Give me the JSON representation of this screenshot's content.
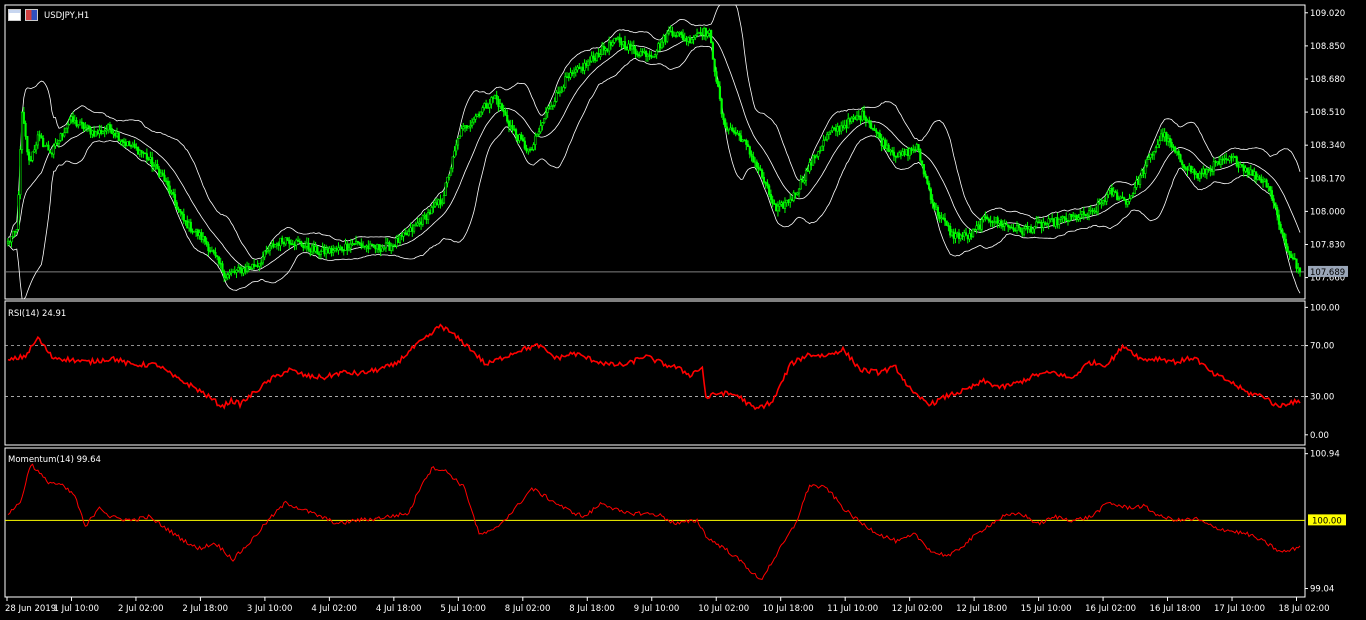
{
  "colors": {
    "background": "#000000",
    "frame": "#ffffff",
    "candle_up": "#00ff00",
    "candle_body_up": "#000000",
    "candle_down": "#00ff00",
    "bands": "#ffffff",
    "rsi": "#ff0000",
    "momentum": "#ff0000",
    "momentum_ref": "#ffff00",
    "price_line": "#808080",
    "price_tag": "#9aa6b8"
  },
  "header": {
    "symbol": "USDJPY,H1",
    "icons": [
      "chart-window-icon",
      "symbol-icon"
    ]
  },
  "chart_data": [
    {
      "type": "candlestick",
      "title": "USDJPY,H1",
      "ylim": [
        107.55,
        109.06
      ],
      "yticks": [
        "109.020",
        "108.850",
        "108.680",
        "108.510",
        "108.340",
        "108.170",
        "108.000",
        "107.830",
        "107.660"
      ],
      "ytick_values": [
        109.02,
        108.85,
        108.68,
        108.51,
        108.34,
        108.17,
        108.0,
        107.83,
        107.66
      ],
      "current_price": "107.689",
      "current_value": 107.689,
      "anchors": [
        [
          0,
          107.84
        ],
        [
          5,
          107.9
        ],
        [
          8,
          108.5
        ],
        [
          12,
          108.25
        ],
        [
          17,
          108.38
        ],
        [
          25,
          108.3
        ],
        [
          35,
          108.47
        ],
        [
          50,
          108.4
        ],
        [
          58,
          108.43
        ],
        [
          67,
          108.35
        ],
        [
          77,
          108.3
        ],
        [
          88,
          108.18
        ],
        [
          100,
          107.95
        ],
        [
          112,
          107.85
        ],
        [
          124,
          107.67
        ],
        [
          133,
          107.7
        ],
        [
          142,
          107.73
        ],
        [
          150,
          107.82
        ],
        [
          158,
          107.86
        ],
        [
          167,
          107.83
        ],
        [
          177,
          107.79
        ],
        [
          187,
          107.8
        ],
        [
          197,
          107.84
        ],
        [
          207,
          107.81
        ],
        [
          217,
          107.82
        ],
        [
          227,
          107.88
        ],
        [
          237,
          107.97
        ],
        [
          247,
          108.06
        ],
        [
          257,
          108.4
        ],
        [
          267,
          108.5
        ],
        [
          277,
          108.59
        ],
        [
          287,
          108.42
        ],
        [
          297,
          108.3
        ],
        [
          307,
          108.52
        ],
        [
          317,
          108.67
        ],
        [
          327,
          108.74
        ],
        [
          337,
          108.82
        ],
        [
          347,
          108.88
        ],
        [
          357,
          108.82
        ],
        [
          367,
          108.81
        ],
        [
          377,
          108.93
        ],
        [
          387,
          108.88
        ],
        [
          394,
          108.93
        ],
        [
          399,
          108.91
        ],
        [
          407,
          108.45
        ],
        [
          417,
          108.38
        ],
        [
          427,
          108.22
        ],
        [
          437,
          108.0
        ],
        [
          447,
          108.08
        ],
        [
          457,
          108.25
        ],
        [
          467,
          108.4
        ],
        [
          477,
          108.45
        ],
        [
          487,
          108.5
        ],
        [
          497,
          108.36
        ],
        [
          507,
          108.28
        ],
        [
          517,
          108.33
        ],
        [
          527,
          108.02
        ],
        [
          537,
          107.88
        ],
        [
          547,
          107.87
        ],
        [
          557,
          107.97
        ],
        [
          567,
          107.93
        ],
        [
          577,
          107.9
        ],
        [
          587,
          107.93
        ],
        [
          597,
          107.95
        ],
        [
          607,
          107.97
        ],
        [
          617,
          107.99
        ],
        [
          627,
          108.1
        ],
        [
          637,
          108.05
        ],
        [
          647,
          108.23
        ],
        [
          657,
          108.4
        ],
        [
          667,
          108.26
        ],
        [
          677,
          108.18
        ],
        [
          687,
          108.24
        ],
        [
          697,
          108.27
        ],
        [
          707,
          108.2
        ],
        [
          717,
          108.14
        ],
        [
          727,
          107.82
        ],
        [
          735,
          107.69
        ]
      ],
      "series": [
        {
          "name": "upper-band"
        },
        {
          "name": "middle-band"
        },
        {
          "name": "lower-band"
        }
      ]
    },
    {
      "type": "line",
      "label": "RSI(14) 24.91",
      "ylim": [
        0,
        100
      ],
      "yticks": [
        "100.00",
        "70.00",
        "30.00",
        "0.00"
      ],
      "ytick_values": [
        100,
        70,
        30,
        0
      ],
      "levels": [
        70,
        30
      ],
      "anchors": [
        [
          0,
          58
        ],
        [
          10,
          62
        ],
        [
          17,
          76
        ],
        [
          25,
          61
        ],
        [
          45,
          57
        ],
        [
          60,
          60
        ],
        [
          70,
          55
        ],
        [
          85,
          55
        ],
        [
          95,
          45
        ],
        [
          105,
          38
        ],
        [
          112,
          32
        ],
        [
          122,
          22
        ],
        [
          127,
          27
        ],
        [
          132,
          24
        ],
        [
          140,
          33
        ],
        [
          150,
          44
        ],
        [
          160,
          51
        ],
        [
          170,
          46
        ],
        [
          180,
          45
        ],
        [
          190,
          49
        ],
        [
          200,
          48
        ],
        [
          210,
          51
        ],
        [
          220,
          55
        ],
        [
          232,
          70
        ],
        [
          240,
          78
        ],
        [
          246,
          86
        ],
        [
          252,
          80
        ],
        [
          262,
          69
        ],
        [
          272,
          55
        ],
        [
          282,
          61
        ],
        [
          292,
          67
        ],
        [
          302,
          70
        ],
        [
          312,
          60
        ],
        [
          322,
          64
        ],
        [
          332,
          59
        ],
        [
          342,
          55
        ],
        [
          352,
          55
        ],
        [
          362,
          62
        ],
        [
          374,
          55
        ],
        [
          380,
          53
        ],
        [
          388,
          47
        ],
        [
          395,
          53
        ],
        [
          397,
          29
        ],
        [
          405,
          33
        ],
        [
          415,
          31
        ],
        [
          425,
          20
        ],
        [
          435,
          26
        ],
        [
          445,
          55
        ],
        [
          455,
          63
        ],
        [
          465,
          62
        ],
        [
          475,
          67
        ],
        [
          485,
          51
        ],
        [
          495,
          49
        ],
        [
          505,
          53
        ],
        [
          515,
          32
        ],
        [
          525,
          24
        ],
        [
          535,
          31
        ],
        [
          545,
          35
        ],
        [
          555,
          42
        ],
        [
          565,
          37
        ],
        [
          575,
          41
        ],
        [
          585,
          47
        ],
        [
          595,
          49
        ],
        [
          605,
          44
        ],
        [
          615,
          57
        ],
        [
          625,
          55
        ],
        [
          635,
          70
        ],
        [
          645,
          59
        ],
        [
          655,
          60
        ],
        [
          665,
          57
        ],
        [
          675,
          61
        ],
        [
          685,
          48
        ],
        [
          695,
          42
        ],
        [
          705,
          33
        ],
        [
          715,
          30
        ],
        [
          722,
          22
        ],
        [
          730,
          26
        ],
        [
          735,
          25
        ]
      ]
    },
    {
      "type": "line",
      "label": "Momentum(14) 99.64",
      "ylim": [
        99.04,
        100.94
      ],
      "yticks": [
        "100.94",
        "100.00",
        "99.04"
      ],
      "ytick_values": [
        100.94,
        100.0,
        99.04
      ],
      "levels": [
        100.0
      ],
      "highlighted_tick": "100.00",
      "anchors": [
        [
          0,
          100.1
        ],
        [
          7,
          100.25
        ],
        [
          13,
          100.8
        ],
        [
          22,
          100.55
        ],
        [
          30,
          100.5
        ],
        [
          38,
          100.35
        ],
        [
          44,
          99.9
        ],
        [
          52,
          100.2
        ],
        [
          58,
          100.05
        ],
        [
          70,
          100.0
        ],
        [
          80,
          100.05
        ],
        [
          88,
          99.92
        ],
        [
          98,
          99.75
        ],
        [
          108,
          99.6
        ],
        [
          118,
          99.68
        ],
        [
          128,
          99.45
        ],
        [
          138,
          99.7
        ],
        [
          148,
          100.0
        ],
        [
          158,
          100.25
        ],
        [
          168,
          100.15
        ],
        [
          178,
          100.05
        ],
        [
          188,
          99.95
        ],
        [
          198,
          100.0
        ],
        [
          208,
          100.02
        ],
        [
          218,
          100.06
        ],
        [
          228,
          100.1
        ],
        [
          236,
          100.55
        ],
        [
          242,
          100.75
        ],
        [
          250,
          100.68
        ],
        [
          260,
          100.45
        ],
        [
          268,
          99.8
        ],
        [
          276,
          99.85
        ],
        [
          288,
          100.15
        ],
        [
          298,
          100.45
        ],
        [
          308,
          100.3
        ],
        [
          318,
          100.15
        ],
        [
          328,
          100.05
        ],
        [
          338,
          100.25
        ],
        [
          350,
          100.1
        ],
        [
          360,
          100.1
        ],
        [
          370,
          100.08
        ],
        [
          380,
          99.95
        ],
        [
          392,
          100.0
        ],
        [
          398,
          99.75
        ],
        [
          408,
          99.6
        ],
        [
          418,
          99.4
        ],
        [
          428,
          99.15
        ],
        [
          438,
          99.55
        ],
        [
          448,
          99.95
        ],
        [
          456,
          100.5
        ],
        [
          466,
          100.45
        ],
        [
          476,
          100.15
        ],
        [
          486,
          99.95
        ],
        [
          496,
          99.8
        ],
        [
          506,
          99.7
        ],
        [
          516,
          99.8
        ],
        [
          526,
          99.55
        ],
        [
          536,
          99.5
        ],
        [
          546,
          99.7
        ],
        [
          556,
          99.9
        ],
        [
          566,
          100.05
        ],
        [
          576,
          100.1
        ],
        [
          586,
          99.95
        ],
        [
          596,
          100.05
        ],
        [
          606,
          100.0
        ],
        [
          616,
          100.05
        ],
        [
          626,
          100.25
        ],
        [
          636,
          100.18
        ],
        [
          646,
          100.2
        ],
        [
          656,
          100.05
        ],
        [
          666,
          100.0
        ],
        [
          676,
          100.02
        ],
        [
          686,
          99.9
        ],
        [
          696,
          99.85
        ],
        [
          706,
          99.8
        ],
        [
          716,
          99.68
        ],
        [
          724,
          99.55
        ],
        [
          730,
          99.58
        ],
        [
          735,
          99.64
        ]
      ]
    }
  ],
  "x_axis": {
    "ticks": [
      "28 Jun 2019",
      "1 Jul 10:00",
      "2 Jul 02:00",
      "2 Jul 18:00",
      "3 Jul 10:00",
      "4 Jul 02:00",
      "4 Jul 18:00",
      "5 Jul 10:00",
      "8 Jul 02:00",
      "8 Jul 18:00",
      "9 Jul 10:00",
      "10 Jul 02:00",
      "10 Jul 18:00",
      "11 Jul 10:00",
      "12 Jul 02:00",
      "12 Jul 18:00",
      "15 Jul 10:00",
      "16 Jul 02:00",
      "16 Jul 18:00",
      "17 Jul 10:00",
      "18 Jul 02:00"
    ]
  }
}
